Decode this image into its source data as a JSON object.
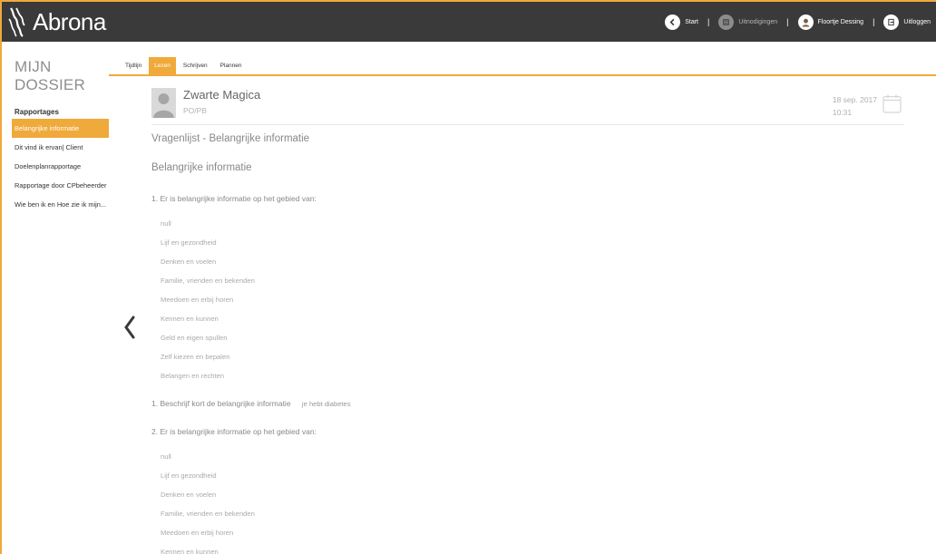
{
  "brand": {
    "name": "Abrona",
    "accent": "#f0a93b",
    "header_bg": "#3a3a3a"
  },
  "topnav": {
    "items": [
      {
        "label": "Start",
        "icon": "chevron-left-circle-icon",
        "dim": false
      },
      {
        "label": "Uitnodigingen",
        "icon": "invitations-icon",
        "dim": true
      },
      {
        "label": "Floortje Dessing",
        "icon": "user-avatar-icon",
        "dim": false
      },
      {
        "label": "Uitloggen",
        "icon": "logout-icon",
        "dim": false
      }
    ],
    "separator": "|"
  },
  "sidebar": {
    "title": "MIJN DOSSIER",
    "section": "Rapportages",
    "items": [
      {
        "label": "Belangrijke informatie",
        "active": true
      },
      {
        "label": "Dit vind ik ervan| Client",
        "active": false
      },
      {
        "label": "Doelenplanrapportage",
        "active": false
      },
      {
        "label": "Rapportage door CPbeheerder",
        "active": false
      },
      {
        "label": "Wie ben ik en Hoe zie ik mijn...",
        "active": false
      }
    ]
  },
  "tabs": [
    {
      "label": "Tijdlijn",
      "active": false
    },
    {
      "label": "Lezen",
      "active": true
    },
    {
      "label": "Schrijven",
      "active": false
    },
    {
      "label": "Plannen",
      "active": false
    }
  ],
  "report": {
    "author_name": "Zwarte Magica",
    "author_role": "PO/PB",
    "date": "18 sep. 2017",
    "time": "10:31",
    "questionnaire_title": "Vragenlijst - Belangrijke informatie",
    "section_title": "Belangrijke informatie",
    "question1": "1. Er is belangrijke informatie op het gebied van:",
    "answers1": [
      "null",
      "Lijf en gezondheid",
      "Denken en voelen",
      "Familie, vrienden en bekenden",
      "Meedoen en erbij horen",
      "Kennen en kunnen",
      "Geld en eigen spullen",
      "Zelf kiezen en bepalen",
      "Belangen en rechten"
    ],
    "describe_question": "1. Beschrijf kort de belangrijke informatie",
    "describe_answer": "je hebt diabetes",
    "question2": "2. Er is belangrijke informatie op het gebied van:",
    "answers2": [
      "null",
      "Lijf en gezondheid",
      "Denken en voelen",
      "Familie, vrienden en bekenden",
      "Meedoen en erbij horen",
      "Kennen en kunnen"
    ]
  }
}
